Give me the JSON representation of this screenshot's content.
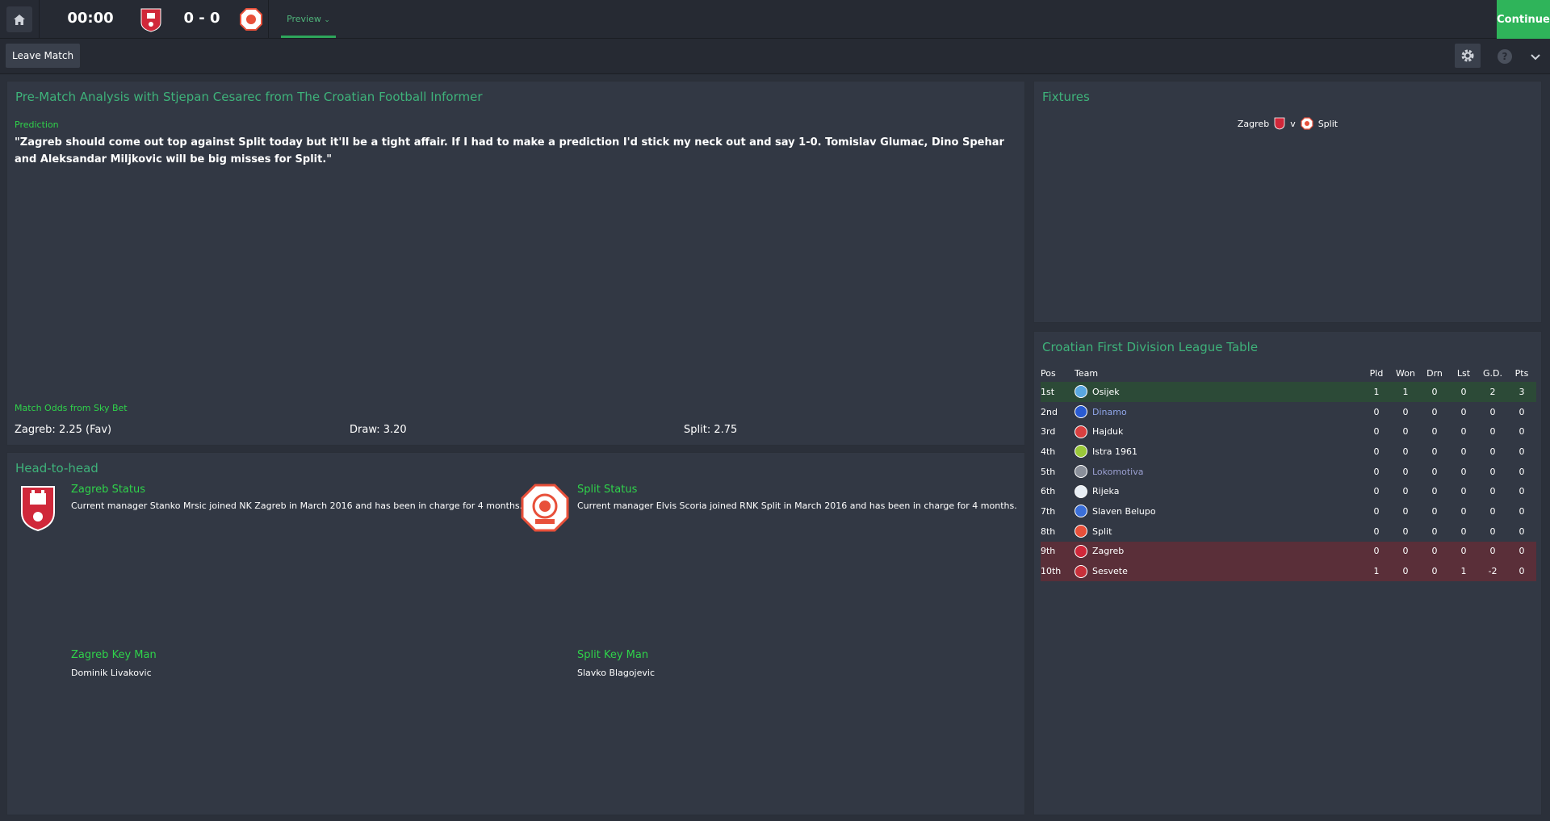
{
  "topbar": {
    "clock": "00:00",
    "score": "0 - 0",
    "tab_preview": "Preview",
    "continue_label": "Continue",
    "home_team_crest": "zagreb-crest",
    "away_team_crest": "split-crest"
  },
  "subbar": {
    "leave_label": "Leave Match",
    "help_label": "?"
  },
  "analysis": {
    "title": "Pre-Match Analysis with Stjepan Cesarec from The Croatian Football Informer",
    "prediction_label": "Prediction",
    "prediction_text": "\"Zagreb should come out top against Split today but it'll be a tight affair. If I had to make a prediction I'd stick my neck out and say 1-0. Tomislav Glumac, Dino Spehar and Aleksandar Miljkovic will be big misses for Split.\"",
    "odds_label": "Match Odds from Sky Bet",
    "odds_home": "Zagreb: 2.25 (Fav)",
    "odds_draw": "Draw: 3.20",
    "odds_away": "Split: 2.75"
  },
  "h2h": {
    "title": "Head-to-head",
    "home_status_title": "Zagreb Status",
    "home_status_text": "Current manager Stanko Mrsic joined NK Zagreb in March 2016 and has been in charge for 4 months.",
    "away_status_title": "Split Status",
    "away_status_text": "Current manager Elvis Scoria joined RNK Split in March 2016 and has been in charge for 4 months.",
    "home_keyman_title": "Zagreb Key Man",
    "home_keyman_name": "Dominik Livakovic",
    "away_keyman_title": "Split Key Man",
    "away_keyman_name": "Slavko Blagojevic"
  },
  "fixtures": {
    "title": "Fixtures",
    "home": "Zagreb",
    "vs": "v",
    "away": "Split"
  },
  "league": {
    "title": "Croatian First Division League Table",
    "headers": [
      "Pos",
      "Team",
      "Pld",
      "Won",
      "Drn",
      "Lst",
      "G.D.",
      "Pts"
    ],
    "rows": [
      {
        "pos": "1st",
        "team": "Osijek",
        "pld": "1",
        "won": "1",
        "drn": "0",
        "lst": "0",
        "gd": "2",
        "pts": "3",
        "color": "#5aa7e0"
      },
      {
        "pos": "2nd",
        "team": "Dinamo",
        "pld": "0",
        "won": "0",
        "drn": "0",
        "lst": "0",
        "gd": "0",
        "pts": "0",
        "color": "#2a5bd0"
      },
      {
        "pos": "3rd",
        "team": "Hajduk",
        "pld": "0",
        "won": "0",
        "drn": "0",
        "lst": "0",
        "gd": "0",
        "pts": "0",
        "color": "#d94040"
      },
      {
        "pos": "4th",
        "team": "Istra 1961",
        "pld": "0",
        "won": "0",
        "drn": "0",
        "lst": "0",
        "gd": "0",
        "pts": "0",
        "color": "#9ac83a"
      },
      {
        "pos": "5th",
        "team": "Lokomotiva",
        "pld": "0",
        "won": "0",
        "drn": "0",
        "lst": "0",
        "gd": "0",
        "pts": "0",
        "color": "#8a8f9a"
      },
      {
        "pos": "6th",
        "team": "Rijeka",
        "pld": "0",
        "won": "0",
        "drn": "0",
        "lst": "0",
        "gd": "0",
        "pts": "0",
        "color": "#e8eef5"
      },
      {
        "pos": "7th",
        "team": "Slaven Belupo",
        "pld": "0",
        "won": "0",
        "drn": "0",
        "lst": "0",
        "gd": "0",
        "pts": "0",
        "color": "#3b6fd8"
      },
      {
        "pos": "8th",
        "team": "Split",
        "pld": "0",
        "won": "0",
        "drn": "0",
        "lst": "0",
        "gd": "0",
        "pts": "0",
        "color": "#e8503a"
      },
      {
        "pos": "9th",
        "team": "Zagreb",
        "pld": "0",
        "won": "0",
        "drn": "0",
        "lst": "0",
        "gd": "0",
        "pts": "0",
        "color": "#d0283a"
      },
      {
        "pos": "10th",
        "team": "Sesvete",
        "pld": "1",
        "won": "0",
        "drn": "0",
        "lst": "1",
        "gd": "-2",
        "pts": "0",
        "color": "#c8303a"
      }
    ]
  }
}
